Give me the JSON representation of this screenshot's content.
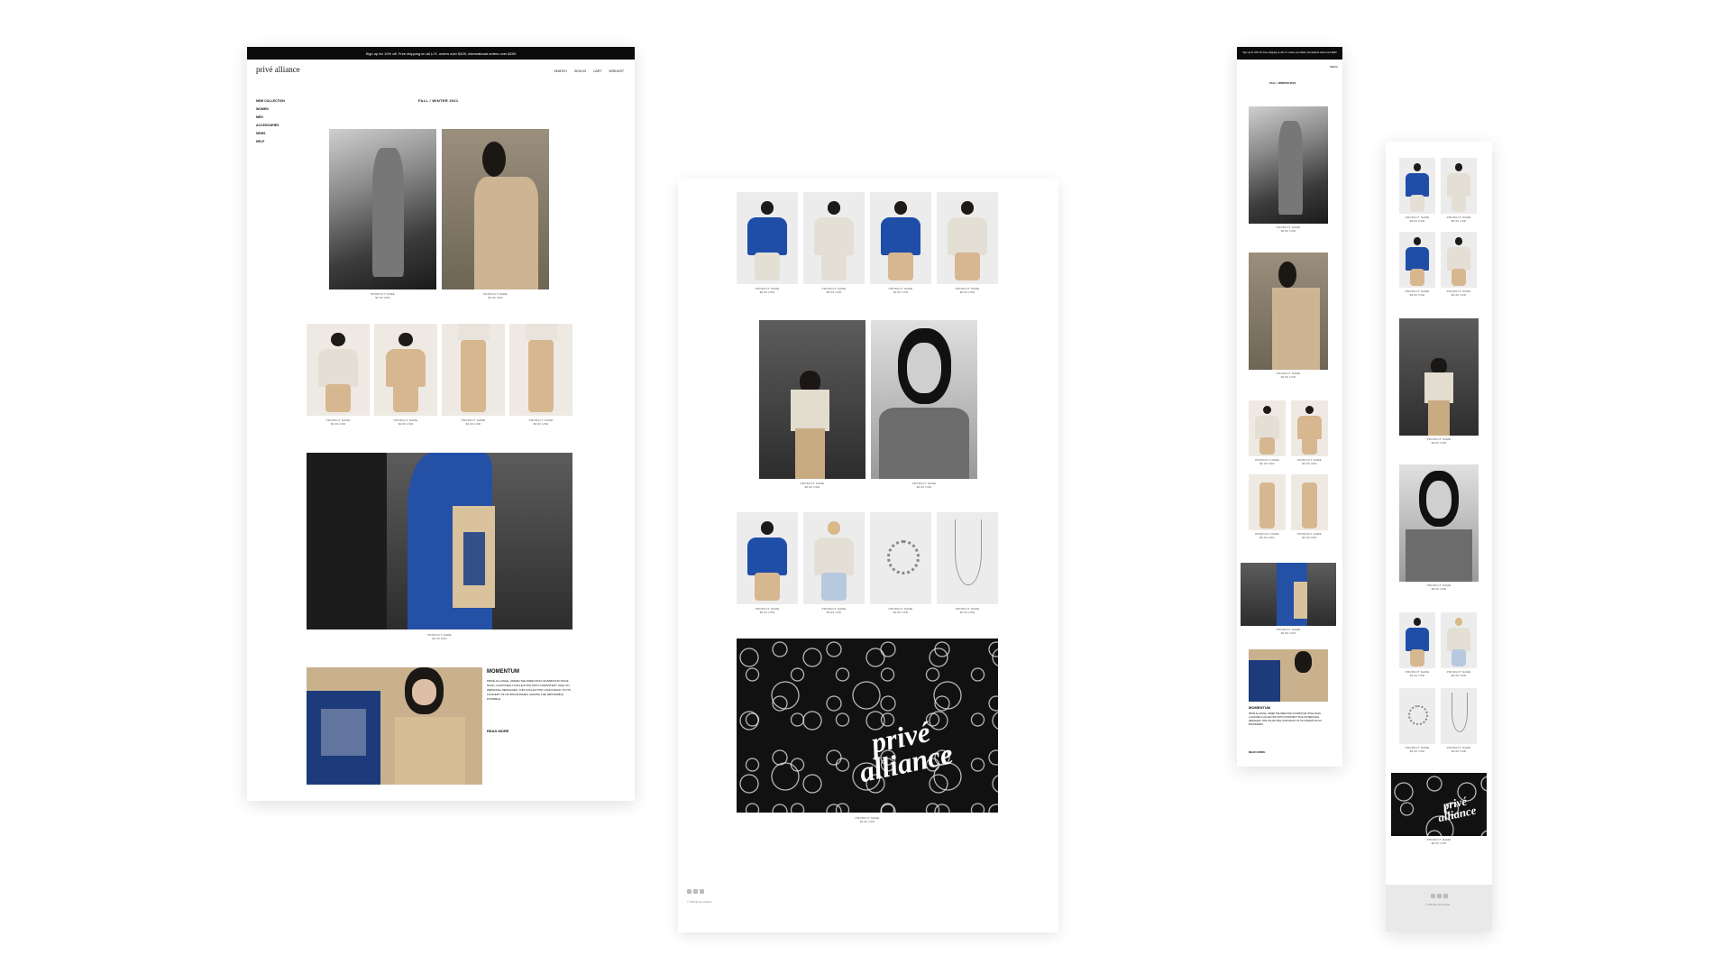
{
  "desktop": {
    "promo": "Sign up for 10% off. Free shipping on all U.S. orders over $100, international orders over $200",
    "logo": "privé alliance",
    "nav": [
      "SEARCH",
      "SIGN IN",
      "CART",
      "WISHLIST"
    ],
    "menu": [
      "NEW COLLECTION",
      "WOMEN",
      "MEN",
      "ACCESSORIES",
      "NEWS",
      "HELP"
    ],
    "section_title": "FALL / WINTER 2021",
    "product_name": "PRODUCT NAME",
    "product_price": "$0.00 USD",
    "momentum_title": "MOMENTUM",
    "momentum_text": "Privé Alliance, under the direction of Babyfur Vince Ngan, launches a collection with consistent take on personal messages. This collection looks back to its concept of no boundaries, making the impossible possible.",
    "read_more": "READ MORE"
  },
  "collection": {
    "product_name": "PRODUCT NAME",
    "product_price": "$0.00 USD",
    "bandana_text": "privé alliance",
    "copyright": "© PRIVÉ ALLIANCE"
  },
  "mobile": {
    "promo": "Sign up for 10% off. Free shipping on all U.S. orders over $100, international orders over $200",
    "menu": "MENU",
    "section_title": "FALL / WINTER 2021",
    "product_name": "PRODUCT NAME",
    "product_price": "$0.00 USD",
    "momentum_title": "MOMENTUM",
    "momentum_text": "Privé Alliance, under the direction of Babyfur Vince Ngan, launches a collection with consistent take on personal messages. This collection looks back to its concept of no boundaries.",
    "read_more": "READ MORE"
  },
  "mobile_products": {
    "product_name": "PRODUCT NAME",
    "product_price": "$0.00 USD",
    "bandana_text": "privé alliance",
    "copyright": "© PRIVÉ ALLIANCE"
  }
}
